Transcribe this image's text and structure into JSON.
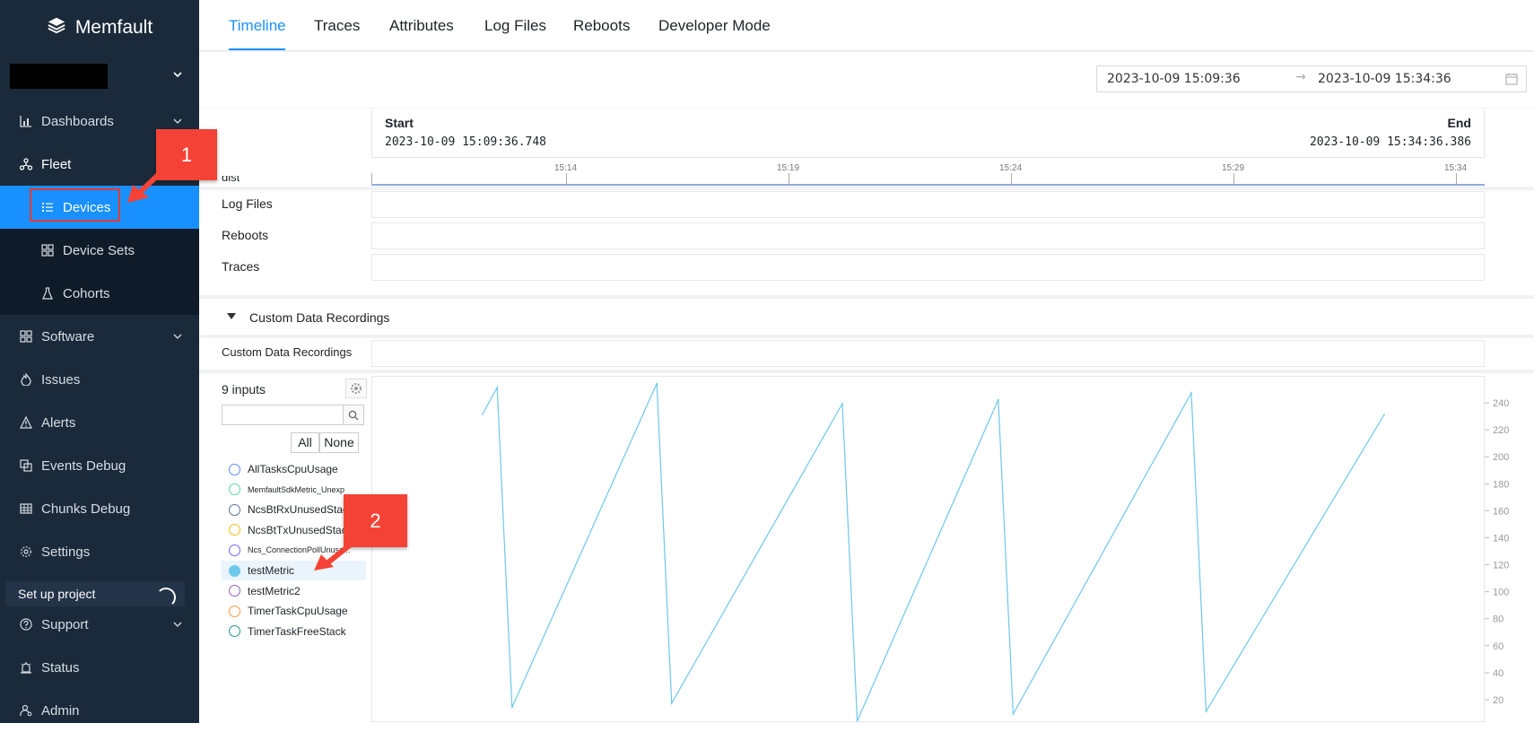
{
  "brand": {
    "name": "Memfault"
  },
  "sidebar": {
    "items": [
      {
        "label": "Dashboards",
        "icon": "bar-chart-icon",
        "has_chevron": true
      },
      {
        "label": "Fleet",
        "icon": "fleet-icon",
        "has_chevron": false
      },
      {
        "label": "Devices",
        "icon": "list-icon",
        "sub": true,
        "active": true
      },
      {
        "label": "Device Sets",
        "icon": "device-sets-icon",
        "sub": true
      },
      {
        "label": "Cohorts",
        "icon": "flask-icon",
        "sub": true
      },
      {
        "label": "Software",
        "icon": "grid-icon",
        "has_chevron": true
      },
      {
        "label": "Issues",
        "icon": "fire-icon"
      },
      {
        "label": "Alerts",
        "icon": "warning-icon"
      },
      {
        "label": "Events Debug",
        "icon": "events-icon"
      },
      {
        "label": "Chunks Debug",
        "icon": "table-icon"
      },
      {
        "label": "Settings",
        "icon": "gear-icon"
      }
    ],
    "setup_label": "Set up project",
    "lower_items": [
      {
        "label": "Support",
        "icon": "question-icon",
        "has_chevron": true
      },
      {
        "label": "Status",
        "icon": "alarm-icon"
      },
      {
        "label": "Admin",
        "icon": "admin-icon"
      }
    ]
  },
  "tabs": [
    "Timeline",
    "Traces",
    "Attributes",
    "Log Files",
    "Reboots",
    "Developer Mode"
  ],
  "active_tab": "Timeline",
  "range": {
    "from": "2023-10-09 15:09:36",
    "to": "2023-10-09 15:34:36"
  },
  "timeline": {
    "start_label": "Start",
    "end_label": "End",
    "start_time": "2023-10-09 15:09:36.748",
    "end_time": "2023-10-09 15:34:36.386",
    "ticks": [
      "15:14",
      "15:19",
      "15:24",
      "15:29",
      "15:34"
    ],
    "partial_label": "dist",
    "rows": [
      "Log Files",
      "Reboots",
      "Traces"
    ]
  },
  "custom_section": {
    "title": "Custom Data Recordings",
    "row_label": "Custom Data Recordings"
  },
  "inputs": {
    "title": "9 inputs",
    "all_label": "All",
    "none_label": "None",
    "series": [
      {
        "name": "AllTasksCpuUsage",
        "color": "#5b8ff9",
        "selected": false,
        "small": false
      },
      {
        "name": "MemfaultSdkMetric_Unexp",
        "color": "#5ad8a6",
        "selected": false,
        "small": true
      },
      {
        "name": "NcsBtRxUnusedStac",
        "color": "#5d7092",
        "selected": false,
        "small": false
      },
      {
        "name": "NcsBtTxUnusedStac",
        "color": "#f6bd16",
        "selected": false,
        "small": false
      },
      {
        "name": "Ncs_ConnectionPollUnuse...",
        "color": "#7262fd",
        "selected": false,
        "small": true
      },
      {
        "name": "testMetric",
        "color": "#6dc8ec",
        "selected": true,
        "small": false
      },
      {
        "name": "testMetric2",
        "color": "#9661bc",
        "selected": false,
        "small": false
      },
      {
        "name": "TimerTaskCpuUsage",
        "color": "#ff9845",
        "selected": false,
        "small": false
      },
      {
        "name": "TimerTaskFreeStack",
        "color": "#1e9493",
        "selected": false,
        "small": false
      }
    ]
  },
  "chart_data": {
    "type": "line",
    "series": [
      {
        "name": "testMetric",
        "color": "#6dc8ec",
        "x": [
          "15:12:05",
          "15:12:25",
          "15:12:45",
          "15:16:00",
          "15:16:20",
          "15:20:10",
          "15:20:30",
          "15:23:40",
          "15:24:00",
          "15:28:00",
          "15:28:20",
          "15:32:20"
        ],
        "values": [
          232,
          252,
          15,
          255,
          18,
          240,
          5,
          243,
          10,
          248,
          12,
          232
        ]
      }
    ],
    "y_ticks": [
      20,
      40,
      60,
      80,
      100,
      120,
      140,
      160,
      180,
      200,
      220,
      240
    ],
    "ylim": [
      0,
      260
    ]
  },
  "annotations": [
    {
      "label": "1"
    },
    {
      "label": "2"
    }
  ]
}
